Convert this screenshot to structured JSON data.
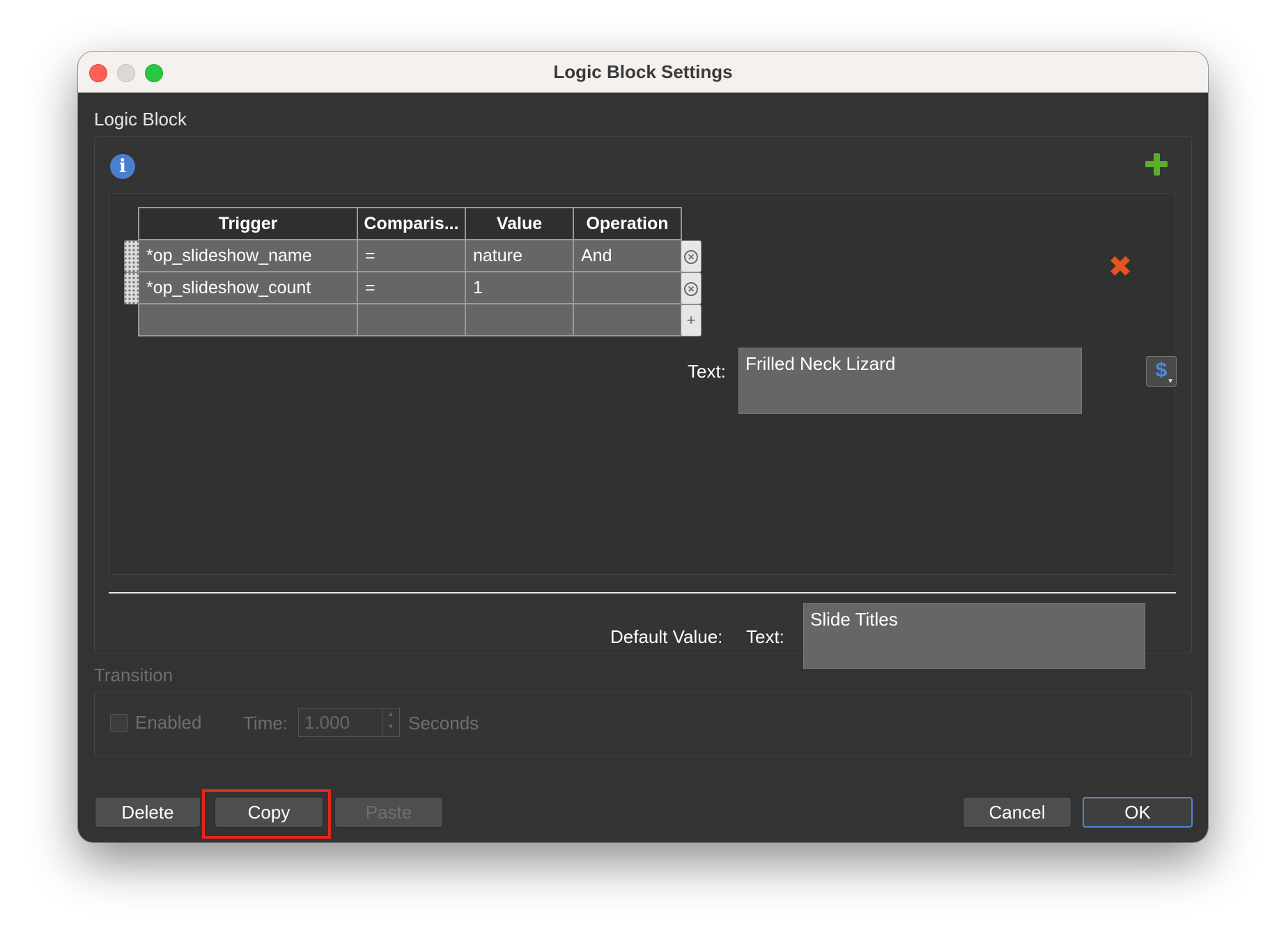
{
  "window": {
    "title": "Logic Block Settings"
  },
  "logic_block": {
    "section_label": "Logic Block",
    "table": {
      "columns": [
        "Trigger",
        "Comparis...",
        "Value",
        "Operation"
      ],
      "rows": [
        {
          "trigger": "*op_slideshow_name",
          "comparison": "=",
          "value": "nature",
          "operation": "And"
        },
        {
          "trigger": "*op_slideshow_count",
          "comparison": "=",
          "value": "1",
          "operation": ""
        }
      ]
    },
    "text_label": "Text:",
    "text_value": "Frilled Neck Lizard",
    "default_value_label": "Default Value:",
    "default_text_label": "Text:",
    "default_text_value": "Slide Titles"
  },
  "transition": {
    "section_label": "Transition",
    "enabled_label": "Enabled",
    "time_label": "Time:",
    "time_value": "1.000",
    "unit_label": "Seconds"
  },
  "buttons": {
    "delete": "Delete",
    "copy": "Copy",
    "paste": "Paste",
    "cancel": "Cancel",
    "ok": "OK"
  },
  "colors": {
    "add_icon": "#5cae2a",
    "remove_icon": "#e4541f",
    "info_icon": "#4a7fd0",
    "highlight": "#e4251b"
  }
}
